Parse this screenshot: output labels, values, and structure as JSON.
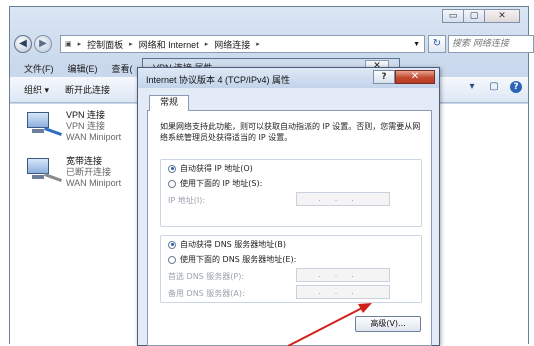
{
  "explorer": {
    "caption_buttons": [
      "▭",
      "▢",
      "✕"
    ],
    "breadcrumb": [
      "控制面板",
      "网络和 Internet",
      "网络连接"
    ],
    "search_placeholder": "搜索 网络连接",
    "menu": [
      "文件(F)",
      "编辑(E)",
      "查看("
    ],
    "commands": [
      "组织 ▾",
      "断开此连接"
    ],
    "connections": [
      {
        "name": "VPN 连接",
        "status": "VPN 连接",
        "device": "WAN Miniport"
      },
      {
        "name": "宽带连接",
        "status": "已断开连接",
        "device": "WAN Miniport"
      }
    ]
  },
  "props_dialog": {
    "title": "VPN 连接 属性",
    "close": "✕"
  },
  "dialog": {
    "title": "Internet 协议版本 4 (TCP/IPv4) 属性",
    "help": "?",
    "close": "✕",
    "tab": "常规",
    "description": "如果网络支持此功能，则可以获取自动指派的 IP 设置。否则，您需要从网络系统管理员处获得适当的 IP 设置。",
    "ip_auto": "自动获得 IP 地址(O)",
    "ip_manual": "使用下面的 IP 地址(S):",
    "ip_label": "IP 地址(I):",
    "dns_auto": "自动获得 DNS 服务器地址(B)",
    "dns_manual": "使用下面的 DNS 服务器地址(E):",
    "dns_primary": "首选 DNS 服务器(P):",
    "dns_alternate": "备用 DNS 服务器(A):",
    "ip_placeholder": "...",
    "advanced": "高级(V)...",
    "selected_ip_mode": "auto",
    "selected_dns_mode": "auto"
  },
  "colors": {
    "arrow": "#d0211a",
    "close_button": "#c44a31"
  }
}
